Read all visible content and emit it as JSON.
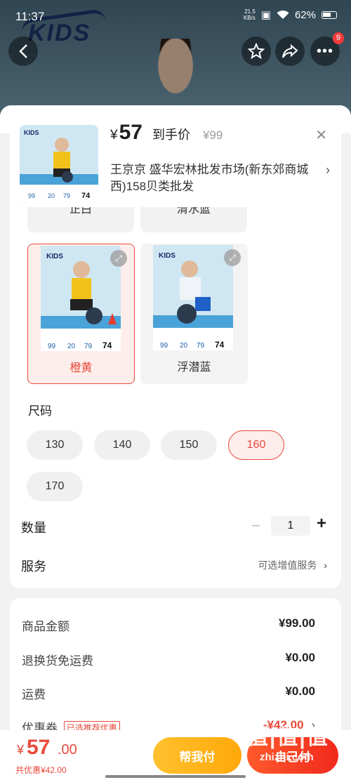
{
  "status": {
    "time": "11:37",
    "net_speed_top": "21.5",
    "net_speed_bottom": "KB/s",
    "battery": "62%"
  },
  "header": {
    "brand_logo": "KIDS",
    "cart_badge": "9"
  },
  "product": {
    "currency": "¥",
    "price": "57",
    "price_label": "到手价",
    "original_price": "¥99",
    "shop": "王京京  盛华宏林批发市场(新东郊商城西)158贝类批发"
  },
  "colors": {
    "partial": [
      "正白",
      "清水蓝"
    ],
    "options": [
      {
        "label": "橙黄",
        "selected": true
      },
      {
        "label": "浮潜蓝",
        "selected": false
      }
    ]
  },
  "sizes": {
    "title": "尺码",
    "options": [
      {
        "label": "130",
        "selected": false
      },
      {
        "label": "140",
        "selected": false
      },
      {
        "label": "150",
        "selected": false
      },
      {
        "label": "160",
        "selected": true
      },
      {
        "label": "170",
        "selected": false
      }
    ]
  },
  "quantity": {
    "label": "数量",
    "value": "1"
  },
  "service": {
    "label": "服务",
    "value": "可选增值服务"
  },
  "costs": {
    "goods": {
      "label": "商品金额",
      "value": "¥99.00"
    },
    "return_free": {
      "label": "退换货免运费",
      "value": "¥0.00"
    },
    "shipping": {
      "label": "运费",
      "value": "¥0.00"
    },
    "coupon": {
      "label": "优惠券",
      "tag": "已选推荐优惠",
      "value": "-¥42.00"
    }
  },
  "bottom": {
    "currency": "¥",
    "total_int": "57",
    "total_dec": ".00",
    "discount_text": "共优惠¥42.00",
    "help_pay": "帮我付",
    "self_pay": "自己付"
  },
  "watermark": {
    "text": "值|值|值",
    "sub": "zhizhi.com"
  },
  "accent": "#e84a3c"
}
